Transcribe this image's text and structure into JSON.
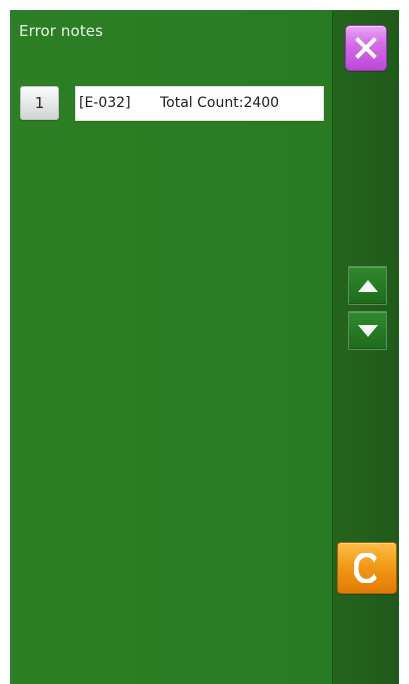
{
  "screen": {
    "title": "Error notes"
  },
  "errors": [
    {
      "index": "1",
      "code": "[E-032]",
      "total_count": "Total Count:2400"
    }
  ],
  "controls": {
    "close_icon": "close-x-icon",
    "scroll_up_icon": "triangle-up-icon",
    "scroll_down_icon": "triangle-down-icon",
    "clear_icon": "clear-c-icon"
  },
  "colors": {
    "background": "#2a7d24",
    "close_button": "#d36ee8",
    "clear_button": "#f29a18",
    "row_field": "#ffffff"
  }
}
